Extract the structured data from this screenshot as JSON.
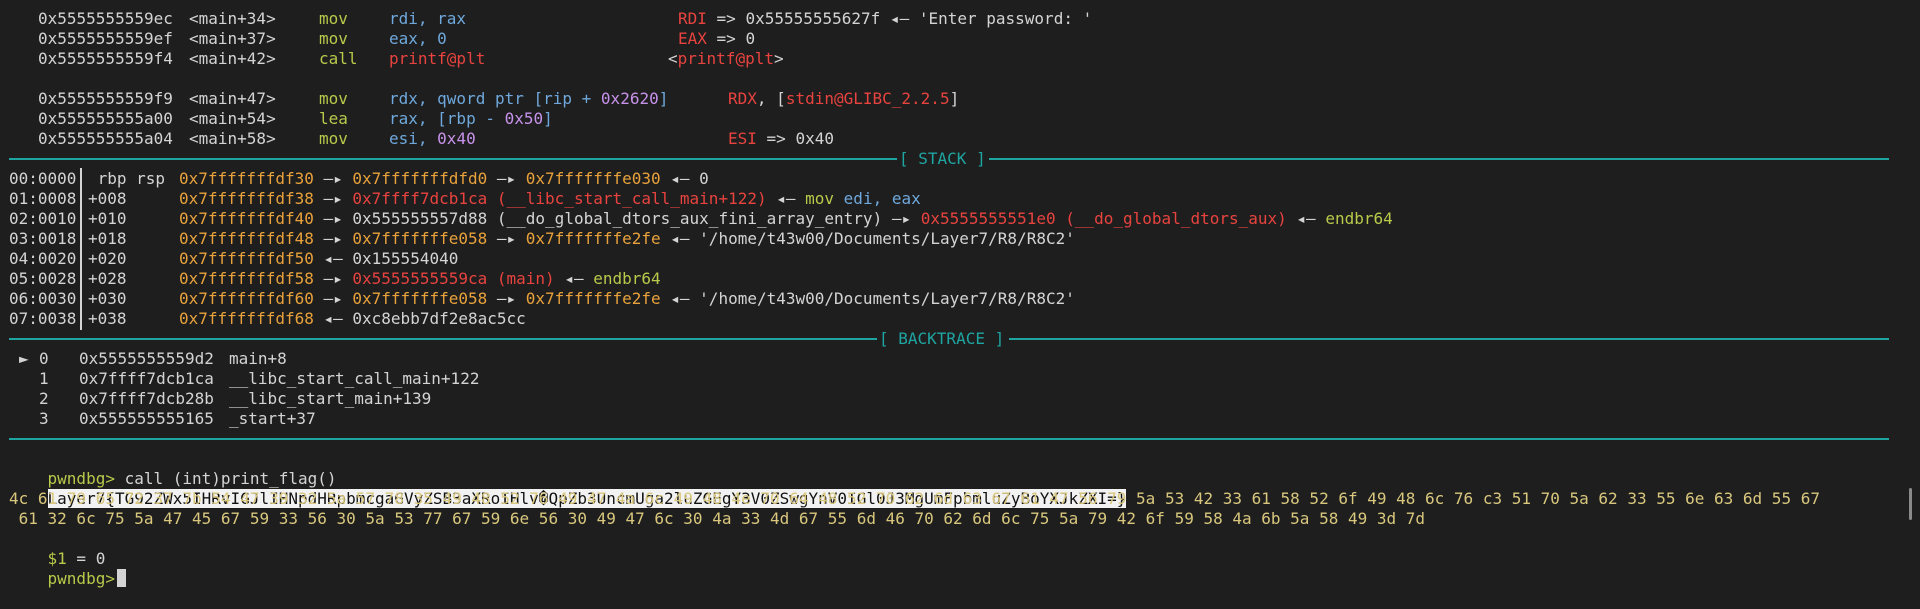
{
  "disasm": [
    {
      "addr": "0x5555555559ec",
      "sym": "<main+34>",
      "mnem": "mov",
      "ops": [
        {
          "t": "rdi, rax",
          "c": "blue"
        }
      ],
      "ann": [
        {
          "t": "RDI",
          "c": "red"
        },
        {
          "t": " => 0x55555555627f ◂— 'Enter password: '",
          "c": "white"
        }
      ]
    },
    {
      "addr": "0x5555555559ef",
      "sym": "<main+37>",
      "mnem": "mov",
      "ops": [
        {
          "t": "eax, 0",
          "c": "blue"
        }
      ],
      "ann": [
        {
          "t": "EAX",
          "c": "red"
        },
        {
          "t": " => 0",
          "c": "white"
        }
      ]
    },
    {
      "addr": "0x5555555559f4",
      "sym": "<main+42>",
      "mnem": "call",
      "ops": [
        {
          "t": "printf@plt",
          "c": "red"
        }
      ],
      "ann": [
        {
          "t": "<",
          "c": "white"
        },
        {
          "t": "printf@plt",
          "c": "red"
        },
        {
          "t": ">",
          "c": "white"
        }
      ]
    },
    {
      "addr": "0x5555555559f9",
      "sym": "<main+47>",
      "mnem": "mov",
      "ops": [
        {
          "t": "rdx, qword ptr [rip + ",
          "c": "blue"
        },
        {
          "t": "0x2620",
          "c": "purple"
        },
        {
          "t": "]",
          "c": "blue"
        }
      ],
      "ann": [
        {
          "t": "RDX",
          "c": "red"
        },
        {
          "t": ", [",
          "c": "white"
        },
        {
          "t": "stdin@GLIBC_2.2.5",
          "c": "red"
        },
        {
          "t": "]",
          "c": "white"
        }
      ]
    },
    {
      "addr": "0x555555555a00",
      "sym": "<main+54>",
      "mnem": "lea",
      "ops": [
        {
          "t": "rax, [rbp - ",
          "c": "blue"
        },
        {
          "t": "0x50",
          "c": "purple"
        },
        {
          "t": "]",
          "c": "blue"
        }
      ],
      "ann": []
    },
    {
      "addr": "0x555555555a04",
      "sym": "<main+58>",
      "mnem": "mov",
      "ops": [
        {
          "t": "esi, ",
          "c": "blue"
        },
        {
          "t": "0x40",
          "c": "purple"
        }
      ],
      "ann": [
        {
          "t": "ESI",
          "c": "red"
        },
        {
          "t": " => 0x40",
          "c": "white"
        }
      ]
    }
  ],
  "stack_title": "[ STACK ]",
  "stack": [
    {
      "idx": "00:0000",
      "off": " rbp rsp",
      "val": [
        {
          "t": "0x7fffffffdf30",
          "c": "orange"
        },
        {
          "t": " —▸ ",
          "c": "white"
        },
        {
          "t": "0x7fffffffdfd0",
          "c": "orange"
        },
        {
          "t": " —▸ ",
          "c": "white"
        },
        {
          "t": "0x7fffffffe030",
          "c": "orange"
        },
        {
          "t": " ◂— 0",
          "c": "white"
        }
      ]
    },
    {
      "idx": "01:0008",
      "off": "+008",
      "val": [
        {
          "t": "0x7fffffffdf38",
          "c": "orange"
        },
        {
          "t": " —▸ ",
          "c": "white"
        },
        {
          "t": "0x7ffff7dcb1ca (__libc_start_call_main+122)",
          "c": "red"
        },
        {
          "t": " ◂— ",
          "c": "white"
        },
        {
          "t": "mov ",
          "c": "green"
        },
        {
          "t": "edi, eax",
          "c": "blue"
        }
      ]
    },
    {
      "idx": "02:0010",
      "off": "+010",
      "val": [
        {
          "t": "0x7fffffffdf40",
          "c": "orange"
        },
        {
          "t": " —▸ 0x555555557d88 (__do_global_dtors_aux_fini_array_entry) —▸ ",
          "c": "white"
        },
        {
          "t": "0x5555555551e0 (__do_global_dtors_aux)",
          "c": "red"
        },
        {
          "t": " ◂— ",
          "c": "white"
        },
        {
          "t": "endbr64",
          "c": "green"
        }
      ]
    },
    {
      "idx": "03:0018",
      "off": "+018",
      "val": [
        {
          "t": "0x7fffffffdf48",
          "c": "orange"
        },
        {
          "t": " —▸ ",
          "c": "white"
        },
        {
          "t": "0x7fffffffe058",
          "c": "orange"
        },
        {
          "t": " —▸ ",
          "c": "white"
        },
        {
          "t": "0x7fffffffe2fe",
          "c": "orange"
        },
        {
          "t": " ◂— '/home/t43w00/Documents/Layer7/R8/R8C2'",
          "c": "white"
        }
      ]
    },
    {
      "idx": "04:0020",
      "off": "+020",
      "val": [
        {
          "t": "0x7fffffffdf50",
          "c": "orange"
        },
        {
          "t": " ◂— 0x155554040",
          "c": "white"
        }
      ]
    },
    {
      "idx": "05:0028",
      "off": "+028",
      "val": [
        {
          "t": "0x7fffffffdf58",
          "c": "orange"
        },
        {
          "t": " —▸ ",
          "c": "white"
        },
        {
          "t": "0x5555555559ca (main)",
          "c": "red"
        },
        {
          "t": " ◂— ",
          "c": "white"
        },
        {
          "t": "endbr64",
          "c": "green"
        }
      ]
    },
    {
      "idx": "06:0030",
      "off": "+030",
      "val": [
        {
          "t": "0x7fffffffdf60",
          "c": "orange"
        },
        {
          "t": " —▸ ",
          "c": "white"
        },
        {
          "t": "0x7fffffffe058",
          "c": "orange"
        },
        {
          "t": " —▸ ",
          "c": "white"
        },
        {
          "t": "0x7fffffffe2fe",
          "c": "orange"
        },
        {
          "t": " ◂— '/home/t43w00/Documents/Layer7/R8/R8C2'",
          "c": "white"
        }
      ]
    },
    {
      "idx": "07:0038",
      "off": "+038",
      "val": [
        {
          "t": "0x7fffffffdf68",
          "c": "orange"
        },
        {
          "t": " ◂— 0xc8ebb7df2e8ac5cc",
          "c": "white"
        }
      ]
    }
  ],
  "backtrace_title": "[ BACKTRACE ]",
  "backtrace": [
    {
      "marker": "►",
      "num": "0",
      "addr": "0x5555555559d2",
      "sym": "main+8"
    },
    {
      "marker": " ",
      "num": "1",
      "addr": "0x7ffff7dcb1ca",
      "sym": "__libc_start_call_main+122"
    },
    {
      "marker": " ",
      "num": "2",
      "addr": "0x7ffff7dcb28b",
      "sym": "__libc_start_main+139"
    },
    {
      "marker": " ",
      "num": "3",
      "addr": "0x555555555165",
      "sym": "_start+37"
    }
  ],
  "prompt": "pwndbg>",
  "command": " call (int)print_flag()",
  "flag_output": "Layer7{TG92ZWx5IHRvIGJlIHNpdHRpbmcgaGVyZSB3aXRoIHlv�QpZb3UncmUga2luZGEgY3V0ZSwgYnV0IGl0J3MgUmFpbmluZyBoYXJkZXI=}",
  "hex_line1": "4c 61 79 65 72 37 7b 54 47 39 32 5a 57 78 35 49 48 52 76 49 47 4a 6c 49 48 4e 70 64 48 52 70 62 6d 63 67 61 47 56 79 5a 53 42 33 61 58 52 6f 49 48 6c 76 c3 51 70 5a 62 33 55 6e 63 6d 55 67",
  "hex_line2": " 61 32 6c 75 5a 47 45 67 59 33 56 30 5a 53 77 67 59 6e 56 30 49 47 6c 30 4a 33 4d 67 55 6d 46 70 62 6d 6c 75 5a 79 42 6f 59 58 4a 6b 5a 58 49 3d 7d",
  "result_var": "$1",
  "result_val": " = 0",
  "prompt2": "pwndbg>"
}
